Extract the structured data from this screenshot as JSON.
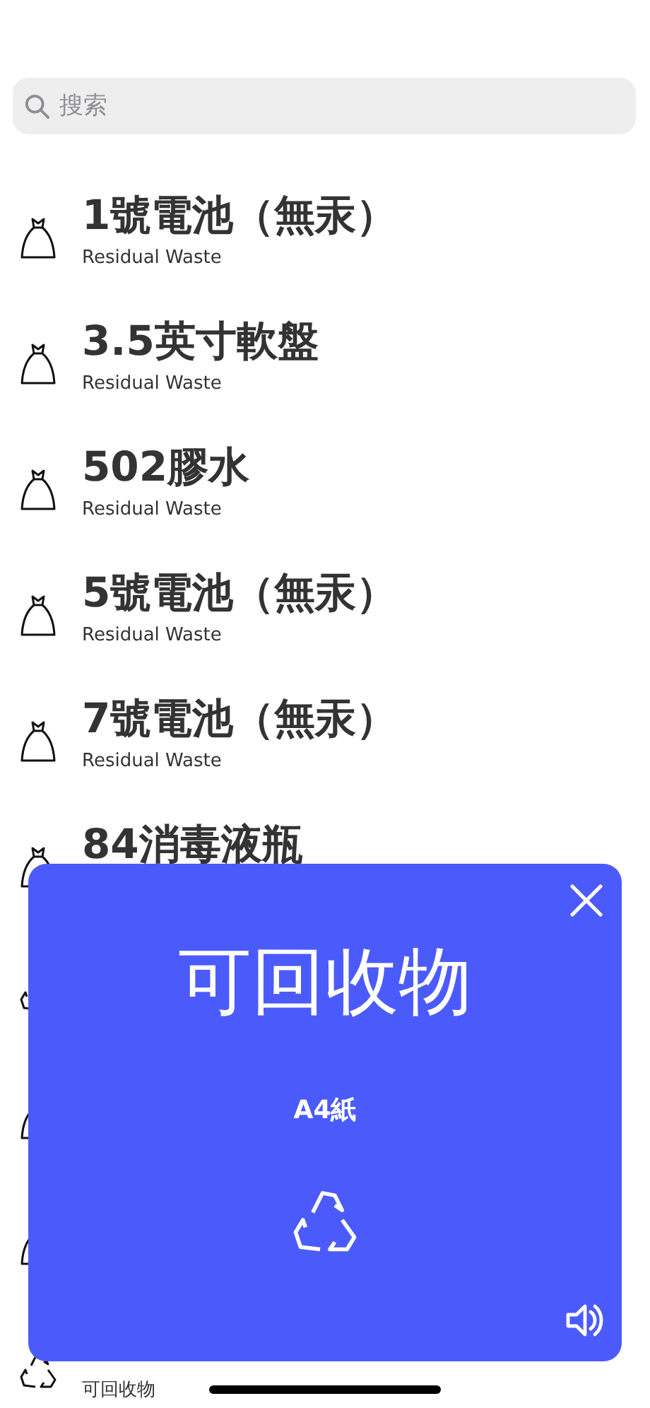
{
  "search": {
    "placeholder": "搜索"
  },
  "items": [
    {
      "title": "1號電池（無汞）",
      "category": "Residual Waste",
      "kind": "bag"
    },
    {
      "title": "3.5英寸軟盤",
      "category": "Residual Waste",
      "kind": "bag"
    },
    {
      "title": "502膠水",
      "category": "Residual Waste",
      "kind": "bag"
    },
    {
      "title": "5號電池（無汞）",
      "category": "Residual Waste",
      "kind": "bag"
    },
    {
      "title": "7號電池（無汞）",
      "category": "Residual Waste",
      "kind": "bag"
    },
    {
      "title": "84消毒液瓶",
      "kind": "bag"
    },
    {
      "kind": "recycle"
    },
    {
      "kind": "bag"
    },
    {
      "kind": "bag"
    },
    {
      "category": "可回收物",
      "kind": "recycle"
    }
  ],
  "popup": {
    "category": "可回收物",
    "item": "A4紙",
    "kind": "recycle"
  }
}
